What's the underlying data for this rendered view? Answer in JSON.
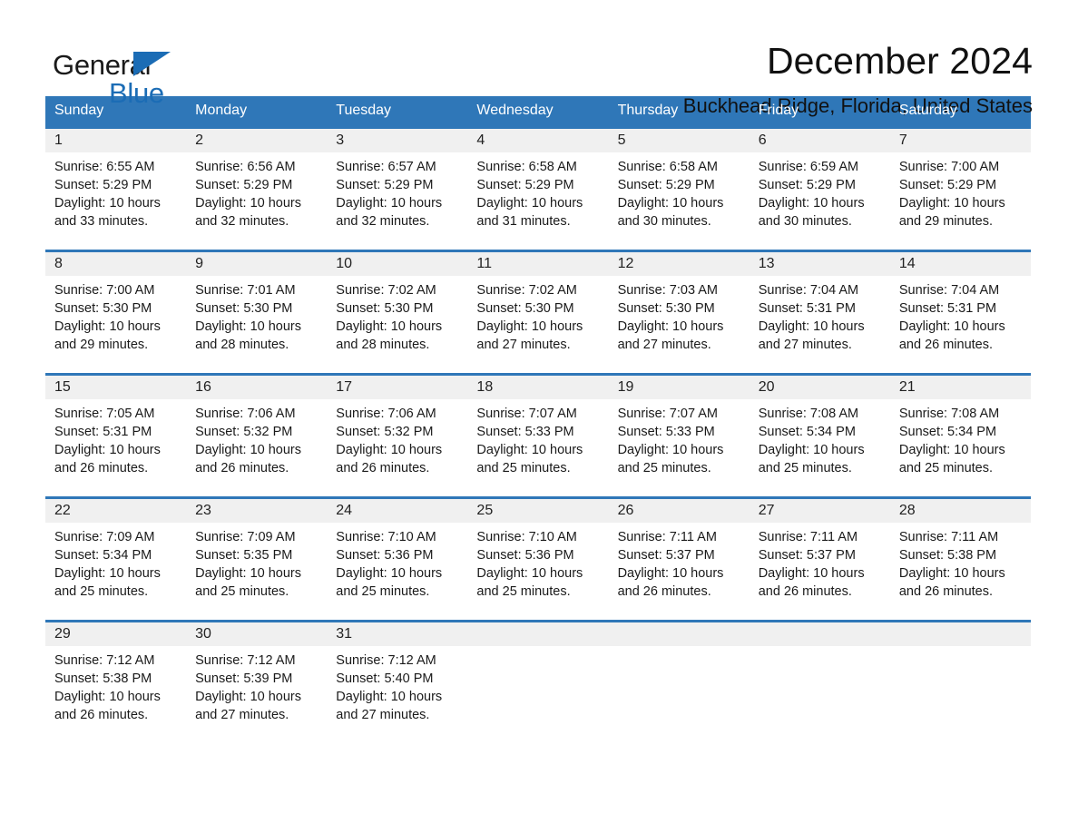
{
  "brand": {
    "name_part1": "General",
    "name_part2": "Blue",
    "accent_color": "#1b6cb5"
  },
  "header": {
    "title": "December 2024",
    "subtitle": "Buckhead Ridge, Florida, United States"
  },
  "calendar": {
    "header_color": "#2f77b8",
    "daynum_band_color": "#f0f0f0",
    "weekday_headers": [
      "Sunday",
      "Monday",
      "Tuesday",
      "Wednesday",
      "Thursday",
      "Friday",
      "Saturday"
    ],
    "weeks": [
      [
        {
          "day": "1",
          "sunrise": "Sunrise: 6:55 AM",
          "sunset": "Sunset: 5:29 PM",
          "daylight_line1": "Daylight: 10 hours",
          "daylight_line2": "and 33 minutes."
        },
        {
          "day": "2",
          "sunrise": "Sunrise: 6:56 AM",
          "sunset": "Sunset: 5:29 PM",
          "daylight_line1": "Daylight: 10 hours",
          "daylight_line2": "and 32 minutes."
        },
        {
          "day": "3",
          "sunrise": "Sunrise: 6:57 AM",
          "sunset": "Sunset: 5:29 PM",
          "daylight_line1": "Daylight: 10 hours",
          "daylight_line2": "and 32 minutes."
        },
        {
          "day": "4",
          "sunrise": "Sunrise: 6:58 AM",
          "sunset": "Sunset: 5:29 PM",
          "daylight_line1": "Daylight: 10 hours",
          "daylight_line2": "and 31 minutes."
        },
        {
          "day": "5",
          "sunrise": "Sunrise: 6:58 AM",
          "sunset": "Sunset: 5:29 PM",
          "daylight_line1": "Daylight: 10 hours",
          "daylight_line2": "and 30 minutes."
        },
        {
          "day": "6",
          "sunrise": "Sunrise: 6:59 AM",
          "sunset": "Sunset: 5:29 PM",
          "daylight_line1": "Daylight: 10 hours",
          "daylight_line2": "and 30 minutes."
        },
        {
          "day": "7",
          "sunrise": "Sunrise: 7:00 AM",
          "sunset": "Sunset: 5:29 PM",
          "daylight_line1": "Daylight: 10 hours",
          "daylight_line2": "and 29 minutes."
        }
      ],
      [
        {
          "day": "8",
          "sunrise": "Sunrise: 7:00 AM",
          "sunset": "Sunset: 5:30 PM",
          "daylight_line1": "Daylight: 10 hours",
          "daylight_line2": "and 29 minutes."
        },
        {
          "day": "9",
          "sunrise": "Sunrise: 7:01 AM",
          "sunset": "Sunset: 5:30 PM",
          "daylight_line1": "Daylight: 10 hours",
          "daylight_line2": "and 28 minutes."
        },
        {
          "day": "10",
          "sunrise": "Sunrise: 7:02 AM",
          "sunset": "Sunset: 5:30 PM",
          "daylight_line1": "Daylight: 10 hours",
          "daylight_line2": "and 28 minutes."
        },
        {
          "day": "11",
          "sunrise": "Sunrise: 7:02 AM",
          "sunset": "Sunset: 5:30 PM",
          "daylight_line1": "Daylight: 10 hours",
          "daylight_line2": "and 27 minutes."
        },
        {
          "day": "12",
          "sunrise": "Sunrise: 7:03 AM",
          "sunset": "Sunset: 5:30 PM",
          "daylight_line1": "Daylight: 10 hours",
          "daylight_line2": "and 27 minutes."
        },
        {
          "day": "13",
          "sunrise": "Sunrise: 7:04 AM",
          "sunset": "Sunset: 5:31 PM",
          "daylight_line1": "Daylight: 10 hours",
          "daylight_line2": "and 27 minutes."
        },
        {
          "day": "14",
          "sunrise": "Sunrise: 7:04 AM",
          "sunset": "Sunset: 5:31 PM",
          "daylight_line1": "Daylight: 10 hours",
          "daylight_line2": "and 26 minutes."
        }
      ],
      [
        {
          "day": "15",
          "sunrise": "Sunrise: 7:05 AM",
          "sunset": "Sunset: 5:31 PM",
          "daylight_line1": "Daylight: 10 hours",
          "daylight_line2": "and 26 minutes."
        },
        {
          "day": "16",
          "sunrise": "Sunrise: 7:06 AM",
          "sunset": "Sunset: 5:32 PM",
          "daylight_line1": "Daylight: 10 hours",
          "daylight_line2": "and 26 minutes."
        },
        {
          "day": "17",
          "sunrise": "Sunrise: 7:06 AM",
          "sunset": "Sunset: 5:32 PM",
          "daylight_line1": "Daylight: 10 hours",
          "daylight_line2": "and 26 minutes."
        },
        {
          "day": "18",
          "sunrise": "Sunrise: 7:07 AM",
          "sunset": "Sunset: 5:33 PM",
          "daylight_line1": "Daylight: 10 hours",
          "daylight_line2": "and 25 minutes."
        },
        {
          "day": "19",
          "sunrise": "Sunrise: 7:07 AM",
          "sunset": "Sunset: 5:33 PM",
          "daylight_line1": "Daylight: 10 hours",
          "daylight_line2": "and 25 minutes."
        },
        {
          "day": "20",
          "sunrise": "Sunrise: 7:08 AM",
          "sunset": "Sunset: 5:34 PM",
          "daylight_line1": "Daylight: 10 hours",
          "daylight_line2": "and 25 minutes."
        },
        {
          "day": "21",
          "sunrise": "Sunrise: 7:08 AM",
          "sunset": "Sunset: 5:34 PM",
          "daylight_line1": "Daylight: 10 hours",
          "daylight_line2": "and 25 minutes."
        }
      ],
      [
        {
          "day": "22",
          "sunrise": "Sunrise: 7:09 AM",
          "sunset": "Sunset: 5:34 PM",
          "daylight_line1": "Daylight: 10 hours",
          "daylight_line2": "and 25 minutes."
        },
        {
          "day": "23",
          "sunrise": "Sunrise: 7:09 AM",
          "sunset": "Sunset: 5:35 PM",
          "daylight_line1": "Daylight: 10 hours",
          "daylight_line2": "and 25 minutes."
        },
        {
          "day": "24",
          "sunrise": "Sunrise: 7:10 AM",
          "sunset": "Sunset: 5:36 PM",
          "daylight_line1": "Daylight: 10 hours",
          "daylight_line2": "and 25 minutes."
        },
        {
          "day": "25",
          "sunrise": "Sunrise: 7:10 AM",
          "sunset": "Sunset: 5:36 PM",
          "daylight_line1": "Daylight: 10 hours",
          "daylight_line2": "and 25 minutes."
        },
        {
          "day": "26",
          "sunrise": "Sunrise: 7:11 AM",
          "sunset": "Sunset: 5:37 PM",
          "daylight_line1": "Daylight: 10 hours",
          "daylight_line2": "and 26 minutes."
        },
        {
          "day": "27",
          "sunrise": "Sunrise: 7:11 AM",
          "sunset": "Sunset: 5:37 PM",
          "daylight_line1": "Daylight: 10 hours",
          "daylight_line2": "and 26 minutes."
        },
        {
          "day": "28",
          "sunrise": "Sunrise: 7:11 AM",
          "sunset": "Sunset: 5:38 PM",
          "daylight_line1": "Daylight: 10 hours",
          "daylight_line2": "and 26 minutes."
        }
      ],
      [
        {
          "day": "29",
          "sunrise": "Sunrise: 7:12 AM",
          "sunset": "Sunset: 5:38 PM",
          "daylight_line1": "Daylight: 10 hours",
          "daylight_line2": "and 26 minutes."
        },
        {
          "day": "30",
          "sunrise": "Sunrise: 7:12 AM",
          "sunset": "Sunset: 5:39 PM",
          "daylight_line1": "Daylight: 10 hours",
          "daylight_line2": "and 27 minutes."
        },
        {
          "day": "31",
          "sunrise": "Sunrise: 7:12 AM",
          "sunset": "Sunset: 5:40 PM",
          "daylight_line1": "Daylight: 10 hours",
          "daylight_line2": "and 27 minutes."
        },
        {
          "day": "",
          "sunrise": "",
          "sunset": "",
          "daylight_line1": "",
          "daylight_line2": ""
        },
        {
          "day": "",
          "sunrise": "",
          "sunset": "",
          "daylight_line1": "",
          "daylight_line2": ""
        },
        {
          "day": "",
          "sunrise": "",
          "sunset": "",
          "daylight_line1": "",
          "daylight_line2": ""
        },
        {
          "day": "",
          "sunrise": "",
          "sunset": "",
          "daylight_line1": "",
          "daylight_line2": ""
        }
      ]
    ]
  }
}
